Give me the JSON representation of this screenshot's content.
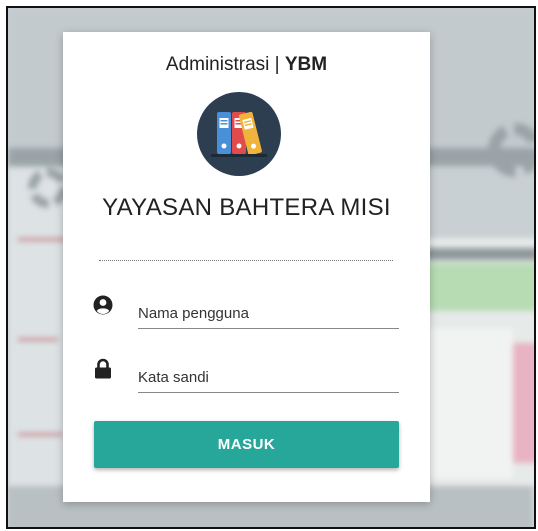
{
  "header": {
    "title_prefix": "Administrasi | ",
    "title_brand": "YBM"
  },
  "logo": {
    "icon": "binders-icon",
    "background_color": "#2c3e50"
  },
  "organization": {
    "name": "YAYASAN BAHTERA MISI"
  },
  "form": {
    "username": {
      "icon": "user-circle-icon",
      "placeholder": "Nama pengguna",
      "value": ""
    },
    "password": {
      "icon": "lock-icon",
      "placeholder": "Kata sandi",
      "value": ""
    },
    "submit_label": "MASUK"
  },
  "colors": {
    "accent": "#27a79a",
    "text": "#222222"
  }
}
